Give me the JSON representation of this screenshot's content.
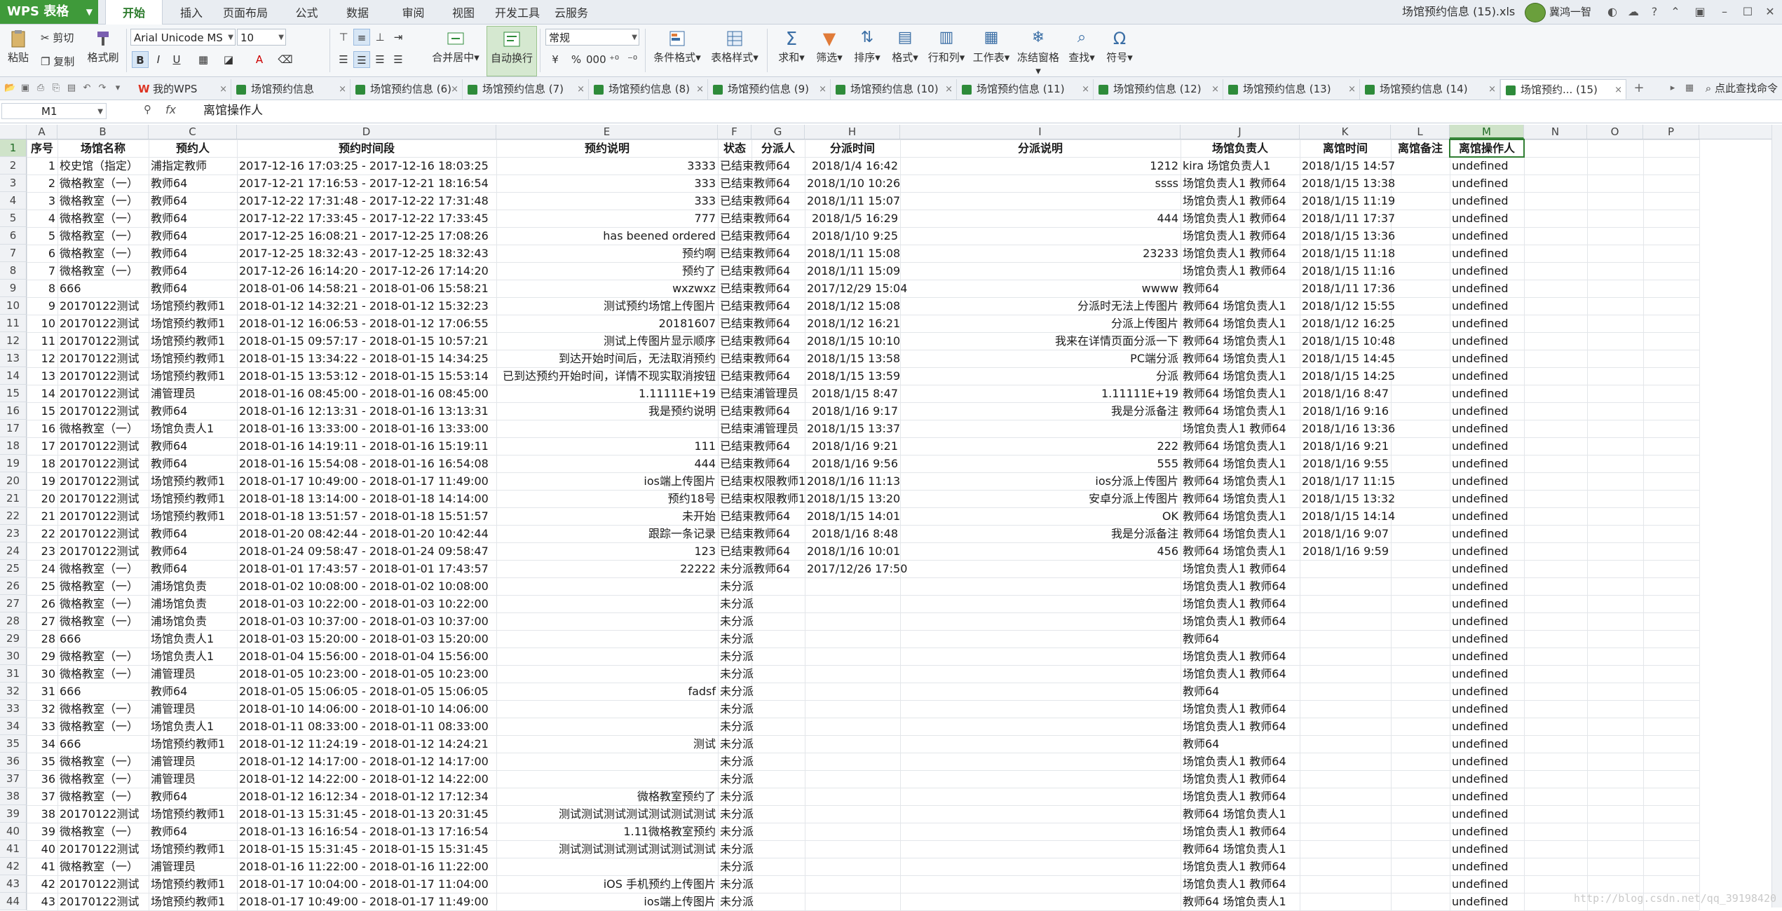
{
  "app": {
    "logo_label": "WPS 表格",
    "document_title": "场馆预约信息 (15).xls",
    "user_name": "冀鸿一智"
  },
  "menu": [
    "开始",
    "插入",
    "页面布局",
    "公式",
    "数据",
    "审阅",
    "视图",
    "开发工具",
    "云服务"
  ],
  "ribbon": {
    "paste": "粘贴",
    "cut": "剪切",
    "copy": "复制",
    "format_painter": "格式刷",
    "font_name": "Arial Unicode MS",
    "font_size": "10",
    "bold": "B",
    "italic": "I",
    "underline": "U",
    "merge_center": "合并居中",
    "wrap_text": "自动换行",
    "number_format": "常规",
    "percent": "%",
    "comma": ",",
    "thousands": "000",
    "conditional_format": "条件格式",
    "table_style": "表格样式",
    "sum": "求和",
    "filter": "筛选",
    "sort": "排序",
    "format": "格式",
    "row_col": "行和列",
    "worksheet": "工作表",
    "freeze": "冻结窗格",
    "find": "查找",
    "symbol": "符号"
  },
  "tabs": [
    {
      "label": "我的WPS",
      "type": "wps"
    },
    {
      "label": "场馆预约信息",
      "type": "xl"
    },
    {
      "label": "场馆预约信息 (6)",
      "type": "xl"
    },
    {
      "label": "场馆预约信息 (7)",
      "type": "xl"
    },
    {
      "label": "场馆预约信息 (8)",
      "type": "xl"
    },
    {
      "label": "场馆预约信息 (9)",
      "type": "xl"
    },
    {
      "label": "场馆预约信息 (10)",
      "type": "xl"
    },
    {
      "label": "场馆预约信息 (11)",
      "type": "xl"
    },
    {
      "label": "场馆预约信息 (12)",
      "type": "xl"
    },
    {
      "label": "场馆预约信息 (13)",
      "type": "xl"
    },
    {
      "label": "场馆预约信息 (14)",
      "type": "xl"
    },
    {
      "label": "场馆预约... (15)",
      "type": "xl",
      "active": true
    }
  ],
  "search_cmd": "点此查找命令",
  "formula_bar": {
    "name_box": "M1",
    "fx": "fx",
    "content": "离馆操作人"
  },
  "columns": [
    "A",
    "B",
    "C",
    "D",
    "E",
    "F",
    "G",
    "H",
    "I",
    "J",
    "K",
    "L",
    "M",
    "N",
    "O",
    "P"
  ],
  "headers": [
    "序号",
    "场馆名称",
    "预约人",
    "预约时间段",
    "预约说明",
    "状态",
    "分派人",
    "分派时间",
    "分派说明",
    "场馆负责人",
    "离馆时间",
    "离馆备注",
    "离馆操作人"
  ],
  "rows": [
    [
      "1",
      "校史馆（指定）",
      "浦指定教师",
      "2017-12-16 17:03:25 - 2017-12-16 18:03:25",
      "3333",
      "已结束",
      "教师64",
      "2018/1/4 16:42",
      "1212",
      "kira 场馆负责人1",
      "2018/1/15 14:57",
      "",
      "undefined"
    ],
    [
      "2",
      "微格教室（一）",
      "教师64",
      "2017-12-21 17:16:53 - 2017-12-21 18:16:54",
      "333",
      "已结束",
      "教师64",
      "2018/1/10 10:26",
      "ssss",
      "场馆负责人1 教师64",
      "2018/1/15 13:38",
      "",
      "undefined"
    ],
    [
      "3",
      "微格教室（一）",
      "教师64",
      "2017-12-22 17:31:48 - 2017-12-22 17:31:48",
      "333",
      "已结束",
      "教师64",
      "2018/1/11 15:07",
      "",
      "场馆负责人1 教师64",
      "2018/1/15 11:19",
      "",
      "undefined"
    ],
    [
      "4",
      "微格教室（一）",
      "教师64",
      "2017-12-22 17:33:45 - 2017-12-22 17:33:45",
      "777",
      "已结束",
      "教师64",
      "2018/1/5 16:29",
      "444",
      "场馆负责人1 教师64",
      "2018/1/11 17:37",
      "",
      "undefined"
    ],
    [
      "5",
      "微格教室（一）",
      "教师64",
      "2017-12-25 16:08:21 - 2017-12-25 17:08:26",
      "has beened ordered",
      "已结束",
      "教师64",
      "2018/1/10 9:25",
      "",
      "场馆负责人1 教师64",
      "2018/1/15 13:36",
      "",
      "undefined"
    ],
    [
      "6",
      "微格教室（一）",
      "教师64",
      "2017-12-25 18:32:43 - 2017-12-25 18:32:43",
      "预约啊",
      "已结束",
      "教师64",
      "2018/1/11 15:08",
      "23233",
      "场馆负责人1 教师64",
      "2018/1/15 11:18",
      "",
      "undefined"
    ],
    [
      "7",
      "微格教室（一）",
      "教师64",
      "2017-12-26 16:14:20 - 2017-12-26 17:14:20",
      "预约了",
      "已结束",
      "教师64",
      "2018/1/11 15:09",
      "",
      "场馆负责人1 教师64",
      "2018/1/15 11:16",
      "",
      "undefined"
    ],
    [
      "8",
      "666",
      "教师64",
      "2018-01-06 14:58:21 - 2018-01-06 15:58:21",
      "wxzwxz",
      "已结束",
      "教师64",
      "2017/12/29 15:04",
      "wwww",
      "教师64",
      "2018/1/11 17:36",
      "",
      "undefined"
    ],
    [
      "9",
      "20170122测试",
      "场馆预约教师1",
      "2018-01-12 14:32:21 - 2018-01-12 15:32:23",
      "测试预约场馆上传图片",
      "已结束",
      "教师64",
      "2018/1/12 15:08",
      "分派时无法上传图片",
      "教师64 场馆负责人1",
      "2018/1/12 15:55",
      "",
      "undefined"
    ],
    [
      "10",
      "20170122测试",
      "场馆预约教师1",
      "2018-01-12 16:06:53 - 2018-01-12 17:06:55",
      "20181607",
      "已结束",
      "教师64",
      "2018/1/12 16:21",
      "分派上传图片",
      "教师64 场馆负责人1",
      "2018/1/12 16:25",
      "",
      "undefined"
    ],
    [
      "11",
      "20170122测试",
      "场馆预约教师1",
      "2018-01-15 09:57:17 - 2018-01-15 10:57:21",
      "测试上传图片显示顺序",
      "已结束",
      "教师64",
      "2018/1/15 10:10",
      "我来在详情页面分派一下",
      "教师64 场馆负责人1",
      "2018/1/15 10:48",
      "",
      "undefined"
    ],
    [
      "12",
      "20170122测试",
      "场馆预约教师1",
      "2018-01-15 13:34:22 - 2018-01-15 14:34:25",
      "到达开始时间后，无法取消预约",
      "已结束",
      "教师64",
      "2018/1/15 13:58",
      "PC端分派",
      "教师64 场馆负责人1",
      "2018/1/15 14:45",
      "",
      "undefined"
    ],
    [
      "13",
      "20170122测试",
      "场馆预约教师1",
      "2018-01-15 13:53:12 - 2018-01-15 15:53:14",
      "已到达预约开始时间，详情不现实取消按钮",
      "已结束",
      "教师64",
      "2018/1/15 13:59",
      "分派",
      "教师64 场馆负责人1",
      "2018/1/15 14:25",
      "",
      "undefined"
    ],
    [
      "14",
      "20170122测试",
      "浦管理员",
      "2018-01-16 08:45:00 - 2018-01-16 08:45:00",
      "1.11111E+19",
      "已结束",
      "浦管理员",
      "2018/1/15 8:47",
      "1.11111E+19",
      "教师64 场馆负责人1",
      "2018/1/16 8:47",
      "",
      "undefined"
    ],
    [
      "15",
      "20170122测试",
      "教师64",
      "2018-01-16 12:13:31 - 2018-01-16 13:13:31",
      "我是预约说明",
      "已结束",
      "教师64",
      "2018/1/16 9:17",
      "我是分派备注",
      "教师64 场馆负责人1",
      "2018/1/16 9:16",
      "",
      "undefined"
    ],
    [
      "16",
      "微格教室（一）",
      "场馆负责人1",
      "2018-01-16 13:33:00 - 2018-01-16 13:33:00",
      "",
      "已结束",
      "浦管理员",
      "2018/1/15 13:37",
      "",
      "场馆负责人1 教师64",
      "2018/1/16 13:36",
      "",
      "undefined"
    ],
    [
      "17",
      "20170122测试",
      "教师64",
      "2018-01-16 14:19:11 - 2018-01-16 15:19:11",
      "111",
      "已结束",
      "教师64",
      "2018/1/16 9:21",
      "222",
      "教师64 场馆负责人1",
      "2018/1/16 9:21",
      "",
      "undefined"
    ],
    [
      "18",
      "20170122测试",
      "教师64",
      "2018-01-16 15:54:08 - 2018-01-16 16:54:08",
      "444",
      "已结束",
      "教师64",
      "2018/1/16 9:56",
      "555",
      "教师64 场馆负责人1",
      "2018/1/16 9:55",
      "",
      "undefined"
    ],
    [
      "19",
      "20170122测试",
      "场馆预约教师1",
      "2018-01-17 10:49:00 - 2018-01-17 11:49:00",
      "ios端上传图片",
      "已结束",
      "权限教师1",
      "2018/1/16 11:13",
      "ios分派上传图片",
      "教师64 场馆负责人1",
      "2018/1/17 11:15",
      "",
      "undefined"
    ],
    [
      "20",
      "20170122测试",
      "场馆预约教师1",
      "2018-01-18 13:14:00 - 2018-01-18 14:14:00",
      "预约18号",
      "已结束",
      "权限教师1",
      "2018/1/15 13:20",
      "安卓分派上传图片",
      "教师64 场馆负责人1",
      "2018/1/15 13:32",
      "",
      "undefined"
    ],
    [
      "21",
      "20170122测试",
      "场馆预约教师1",
      "2018-01-18 13:51:57 - 2018-01-18 15:51:57",
      "未开始",
      "已结束",
      "教师64",
      "2018/1/15 14:01",
      "OK",
      "教师64 场馆负责人1",
      "2018/1/15 14:14",
      "",
      "undefined"
    ],
    [
      "22",
      "20170122测试",
      "教师64",
      "2018-01-20 08:42:44 - 2018-01-20 10:42:44",
      "跟踪一条记录",
      "已结束",
      "教师64",
      "2018/1/16 8:48",
      "我是分派备注",
      "教师64 场馆负责人1",
      "2018/1/16 9:07",
      "",
      "undefined"
    ],
    [
      "23",
      "20170122测试",
      "教师64",
      "2018-01-24 09:58:47 - 2018-01-24 09:58:47",
      "123",
      "已结束",
      "教师64",
      "2018/1/16 10:01",
      "456",
      "教师64 场馆负责人1",
      "2018/1/16 9:59",
      "",
      "undefined"
    ],
    [
      "24",
      "微格教室（一）",
      "教师64",
      "2018-01-01 17:43:57 - 2018-01-01 17:43:57",
      "22222",
      "未分派",
      "教师64",
      "2017/12/26 17:50",
      "",
      "场馆负责人1 教师64",
      "",
      "",
      "undefined"
    ],
    [
      "25",
      "微格教室（一）",
      "浦场馆负责",
      "2018-01-02 10:08:00 - 2018-01-02 10:08:00",
      "",
      "未分派",
      "",
      "",
      "",
      "场馆负责人1 教师64",
      "",
      "",
      "undefined"
    ],
    [
      "26",
      "微格教室（一）",
      "浦场馆负责",
      "2018-01-03 10:22:00 - 2018-01-03 10:22:00",
      "",
      "未分派",
      "",
      "",
      "",
      "场馆负责人1 教师64",
      "",
      "",
      "undefined"
    ],
    [
      "27",
      "微格教室（一）",
      "浦场馆负责",
      "2018-01-03 10:37:00 - 2018-01-03 10:37:00",
      "",
      "未分派",
      "",
      "",
      "",
      "场馆负责人1 教师64",
      "",
      "",
      "undefined"
    ],
    [
      "28",
      "666",
      "场馆负责人1",
      "2018-01-03 15:20:00 - 2018-01-03 15:20:00",
      "",
      "未分派",
      "",
      "",
      "",
      "教师64",
      "",
      "",
      "undefined"
    ],
    [
      "29",
      "微格教室（一）",
      "场馆负责人1",
      "2018-01-04 15:56:00 - 2018-01-04 15:56:00",
      "",
      "未分派",
      "",
      "",
      "",
      "场馆负责人1 教师64",
      "",
      "",
      "undefined"
    ],
    [
      "30",
      "微格教室（一）",
      "浦管理员",
      "2018-01-05 10:23:00 - 2018-01-05 10:23:00",
      "",
      "未分派",
      "",
      "",
      "",
      "场馆负责人1 教师64",
      "",
      "",
      "undefined"
    ],
    [
      "31",
      "666",
      "教师64",
      "2018-01-05 15:06:05 - 2018-01-05 15:06:05",
      "fadsf",
      "未分派",
      "",
      "",
      "",
      "教师64",
      "",
      "",
      "undefined"
    ],
    [
      "32",
      "微格教室（一）",
      "浦管理员",
      "2018-01-10 14:06:00 - 2018-01-10 14:06:00",
      "",
      "未分派",
      "",
      "",
      "",
      "场馆负责人1 教师64",
      "",
      "",
      "undefined"
    ],
    [
      "33",
      "微格教室（一）",
      "场馆负责人1",
      "2018-01-11 08:33:00 - 2018-01-11 08:33:00",
      "",
      "未分派",
      "",
      "",
      "",
      "场馆负责人1 教师64",
      "",
      "",
      "undefined"
    ],
    [
      "34",
      "666",
      "场馆预约教师1",
      "2018-01-12 11:24:19 - 2018-01-12 14:24:21",
      "测试",
      "未分派",
      "",
      "",
      "",
      "教师64",
      "",
      "",
      "undefined"
    ],
    [
      "35",
      "微格教室（一）",
      "浦管理员",
      "2018-01-12 14:17:00 - 2018-01-12 14:17:00",
      "",
      "未分派",
      "",
      "",
      "",
      "场馆负责人1 教师64",
      "",
      "",
      "undefined"
    ],
    [
      "36",
      "微格教室（一）",
      "浦管理员",
      "2018-01-12 14:22:00 - 2018-01-12 14:22:00",
      "",
      "未分派",
      "",
      "",
      "",
      "场馆负责人1 教师64",
      "",
      "",
      "undefined"
    ],
    [
      "37",
      "微格教室（一）",
      "教师64",
      "2018-01-12 16:12:34 - 2018-01-12 17:12:34",
      "微格教室预约了",
      "未分派",
      "",
      "",
      "",
      "场馆负责人1 教师64",
      "",
      "",
      "undefined"
    ],
    [
      "38",
      "20170122测试",
      "场馆预约教师1",
      "2018-01-13 15:31:45 - 2018-01-13 20:31:45",
      "测试测试测试测试测试测试测试",
      "未分派",
      "",
      "",
      "",
      "教师64 场馆负责人1",
      "",
      "",
      "undefined"
    ],
    [
      "39",
      "微格教室（一）",
      "教师64",
      "2018-01-13 16:16:54 - 2018-01-13 17:16:54",
      "1.11微格教室预约",
      "未分派",
      "",
      "",
      "",
      "场馆负责人1 教师64",
      "",
      "",
      "undefined"
    ],
    [
      "40",
      "20170122测试",
      "场馆预约教师1",
      "2018-01-15 15:31:45 - 2018-01-15 15:31:45",
      "测试测试测试测试测试测试测试",
      "未分派",
      "",
      "",
      "",
      "教师64 场馆负责人1",
      "",
      "",
      "undefined"
    ],
    [
      "41",
      "微格教室（一）",
      "浦管理员",
      "2018-01-16 11:22:00 - 2018-01-16 11:22:00",
      "",
      "未分派",
      "",
      "",
      "",
      "场馆负责人1 教师64",
      "",
      "",
      "undefined"
    ],
    [
      "42",
      "20170122测试",
      "场馆预约教师1",
      "2018-01-17 10:04:00 - 2018-01-17 11:04:00",
      "iOS 手机预约上传图片",
      "未分派",
      "",
      "",
      "",
      "场馆负责人1 教师64",
      "",
      "",
      "undefined"
    ],
    [
      "43",
      "20170122测试",
      "场馆预约教师1",
      "2018-01-17 10:49:00 - 2018-01-17 11:49:00",
      "ios端上传图片",
      "未分派",
      "",
      "",
      "",
      "教师64 场馆负责人1",
      "",
      "",
      "undefined"
    ]
  ],
  "watermark": "http://blog.csdn.net/qq_39198420"
}
